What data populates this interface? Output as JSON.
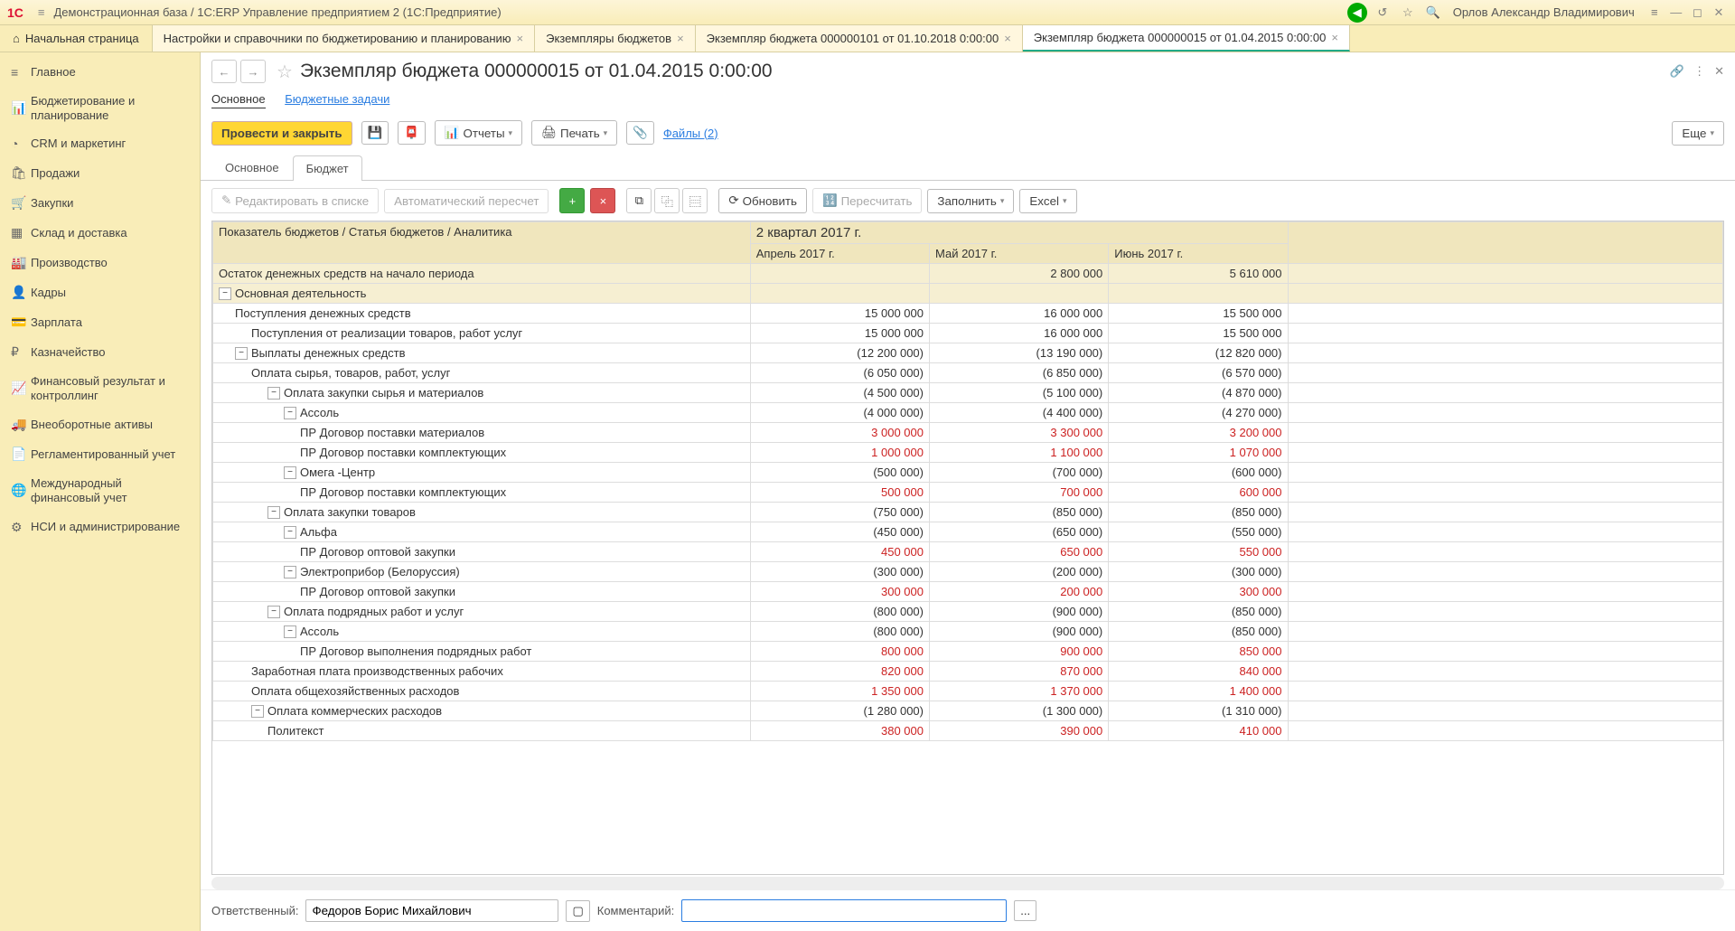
{
  "titlebar": {
    "title": "Демонстрационная база / 1С:ERP Управление предприятием 2  (1С:Предприятие)",
    "user": "Орлов Александр Владимирович"
  },
  "tablist": {
    "home": "Начальная страница",
    "tabs": [
      "Настройки и справочники по бюджетированию и планированию",
      "Экземпляры бюджетов",
      "Экземпляр бюджета 000000101 от 01.10.2018 0:00:00",
      "Экземпляр бюджета 000000015 от 01.04.2015 0:00:00"
    ]
  },
  "sidebar": {
    "items": [
      "Главное",
      "Бюджетирование и планирование",
      "CRM и маркетинг",
      "Продажи",
      "Закупки",
      "Склад и доставка",
      "Производство",
      "Кадры",
      "Зарплата",
      "Казначейство",
      "Финансовый результат и контроллинг",
      "Внеоборотные активы",
      "Регламентированный учет",
      "Международный финансовый учет",
      "НСИ и администрирование"
    ]
  },
  "doc": {
    "title": "Экземпляр бюджета 000000015 от 01.04.2015 0:00:00",
    "sublink_main": "Основное",
    "sublink_tasks": "Бюджетные задачи"
  },
  "cmd": {
    "post_close": "Провести и закрыть",
    "reports": "Отчеты",
    "print": "Печать",
    "files": "Файлы (2)",
    "more": "Еще"
  },
  "innertabs": {
    "main": "Основное",
    "budget": "Бюджет"
  },
  "act": {
    "edit_list": "Редактировать в списке",
    "auto_recalc": "Автоматический пересчет",
    "refresh": "Обновить",
    "recalc": "Пересчитать",
    "fill": "Заполнить",
    "excel": "Excel"
  },
  "grid": {
    "head_indicator": "Показатель бюджетов / Статья бюджетов / Аналитика",
    "period": "2 квартал 2017 г.",
    "months": [
      "Апрель 2017 г.",
      "Май 2017 г.",
      "Июнь 2017 г."
    ],
    "rows": [
      {
        "label": "Остаток денежных средств на начало периода",
        "indent": 0,
        "cat": true,
        "vals": [
          "",
          "2 800 000",
          "5 610 000"
        ]
      },
      {
        "label": "Основная деятельность",
        "indent": 0,
        "cat": true,
        "toggle": true,
        "vals": [
          "",
          "",
          ""
        ]
      },
      {
        "label": "Поступления денежных средств",
        "indent": 1,
        "vals": [
          "15 000 000",
          "16 000 000",
          "15 500 000"
        ]
      },
      {
        "label": "Поступления от реализации товаров, работ услуг",
        "indent": 2,
        "vals": [
          "15 000 000",
          "16 000 000",
          "15 500 000"
        ]
      },
      {
        "label": "Выплаты денежных средств",
        "indent": 1,
        "toggle": true,
        "vals": [
          "(12 200 000)",
          "(13 190 000)",
          "(12 820 000)"
        ]
      },
      {
        "label": "Оплата сырья, товаров, работ, услуг",
        "indent": 2,
        "vals": [
          "(6 050 000)",
          "(6 850 000)",
          "(6 570 000)"
        ]
      },
      {
        "label": "Оплата закупки сырья и материалов",
        "indent": 3,
        "toggle": true,
        "vals": [
          "(4 500 000)",
          "(5 100 000)",
          "(4 870 000)"
        ]
      },
      {
        "label": "Ассоль",
        "indent": 4,
        "toggle": true,
        "vals": [
          "(4 000 000)",
          "(4 400 000)",
          "(4 270 000)"
        ]
      },
      {
        "label": "ПР Договор поставки материалов",
        "indent": 5,
        "red": true,
        "vals": [
          "3 000 000",
          "3 300 000",
          "3 200 000"
        ]
      },
      {
        "label": "ПР Договор поставки комплектующих",
        "indent": 5,
        "red": true,
        "vals": [
          "1 000 000",
          "1 100 000",
          "1 070 000"
        ]
      },
      {
        "label": "Омега -Центр",
        "indent": 4,
        "toggle": true,
        "vals": [
          "(500 000)",
          "(700 000)",
          "(600 000)"
        ]
      },
      {
        "label": "ПР Договор поставки комплектующих",
        "indent": 5,
        "red": true,
        "vals": [
          "500 000",
          "700 000",
          "600 000"
        ]
      },
      {
        "label": "Оплата закупки товаров",
        "indent": 3,
        "toggle": true,
        "vals": [
          "(750 000)",
          "(850 000)",
          "(850 000)"
        ]
      },
      {
        "label": "Альфа",
        "indent": 4,
        "toggle": true,
        "vals": [
          "(450 000)",
          "(650 000)",
          "(550 000)"
        ]
      },
      {
        "label": "ПР Договор оптовой закупки",
        "indent": 5,
        "red": true,
        "vals": [
          "450 000",
          "650 000",
          "550 000"
        ]
      },
      {
        "label": "Электроприбор (Белоруссия)",
        "indent": 4,
        "toggle": true,
        "vals": [
          "(300 000)",
          "(200 000)",
          "(300 000)"
        ]
      },
      {
        "label": "ПР Договор оптовой закупки",
        "indent": 5,
        "red": true,
        "vals": [
          "300 000",
          "200 000",
          "300 000"
        ]
      },
      {
        "label": "Оплата подрядных работ и услуг",
        "indent": 3,
        "toggle": true,
        "vals": [
          "(800 000)",
          "(900 000)",
          "(850 000)"
        ]
      },
      {
        "label": "Ассоль",
        "indent": 4,
        "toggle": true,
        "vals": [
          "(800 000)",
          "(900 000)",
          "(850 000)"
        ]
      },
      {
        "label": "ПР Договор выполнения подрядных работ",
        "indent": 5,
        "red": true,
        "vals": [
          "800 000",
          "900 000",
          "850 000"
        ]
      },
      {
        "label": "Заработная плата производственных рабочих",
        "indent": 2,
        "red": true,
        "vals": [
          "820 000",
          "870 000",
          "840 000"
        ]
      },
      {
        "label": "Оплата общехозяйственных расходов",
        "indent": 2,
        "red": true,
        "vals": [
          "1 350 000",
          "1 370 000",
          "1 400 000"
        ]
      },
      {
        "label": "Оплата коммерческих расходов",
        "indent": 2,
        "toggle": true,
        "vals": [
          "(1 280 000)",
          "(1 300 000)",
          "(1 310 000)"
        ]
      },
      {
        "label": "Политекст",
        "indent": 3,
        "red": true,
        "vals": [
          "380 000",
          "390 000",
          "410 000"
        ]
      }
    ]
  },
  "footer": {
    "resp_label": "Ответственный:",
    "resp_value": "Федоров Борис Михайлович",
    "comment_label": "Комментарий:",
    "comment_value": ""
  }
}
